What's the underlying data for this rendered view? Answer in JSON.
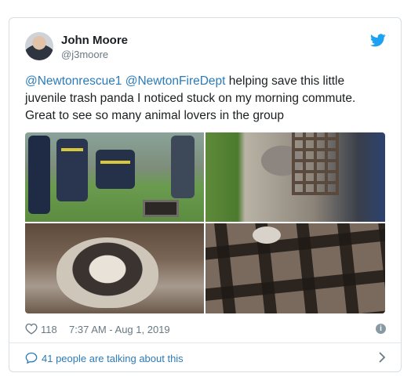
{
  "tweet": {
    "author": {
      "name": "John Moore",
      "handle": "@j3moore",
      "avatar_icon": "avatar"
    },
    "text": {
      "mention1": "@Newtonrescue1",
      "mention2": "@NewtonFireDept",
      "body": " helping save this little juvenile trash panda I noticed stuck on my morning commute. Great to see so many animal lovers in the group"
    },
    "media": {
      "count": 4,
      "images": [
        "firefighters-around-storm-drain",
        "raccoon-in-grate",
        "raccoon-face-closeup",
        "raccoon-paw-through-grate"
      ]
    },
    "likes": "118",
    "timestamp": "7:37 AM - Aug 1, 2019",
    "talking": "41 people are talking about this"
  },
  "colors": {
    "link": "#2b7bb9",
    "twitter_blue": "#1da1f2",
    "muted": "#697882",
    "border": "#d6dde3"
  },
  "icons": {
    "brand": "twitter-bird-icon",
    "like": "heart-icon",
    "info": "info-icon",
    "reply": "speech-bubble-icon",
    "chevron": "chevron-right-icon"
  }
}
